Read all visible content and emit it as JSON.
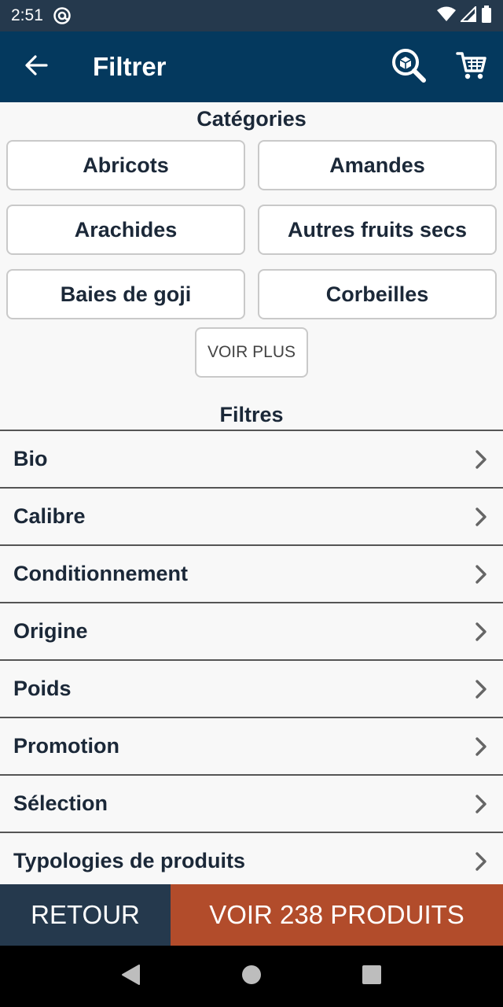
{
  "status_bar": {
    "time": "2:51"
  },
  "app_bar": {
    "title": "Filtrer"
  },
  "categories": {
    "title": "Catégories",
    "items": [
      "Abricots",
      "Amandes",
      "Arachides",
      "Autres fruits secs",
      "Baies de goji",
      "Corbeilles"
    ],
    "more_label": "VOIR PLUS"
  },
  "filters": {
    "title": "Filtres",
    "items": [
      "Bio",
      "Calibre",
      "Conditionnement",
      "Origine",
      "Poids",
      "Promotion",
      "Sélection",
      "Typologies de produits"
    ]
  },
  "bottom_bar": {
    "back_label": "RETOUR",
    "see_label": "VOIR 238 PRODUITS"
  },
  "colors": {
    "app_bar": "#04395e",
    "status_bar": "#25394d",
    "primary_action": "#b24c2b",
    "secondary_action": "#25394d"
  }
}
